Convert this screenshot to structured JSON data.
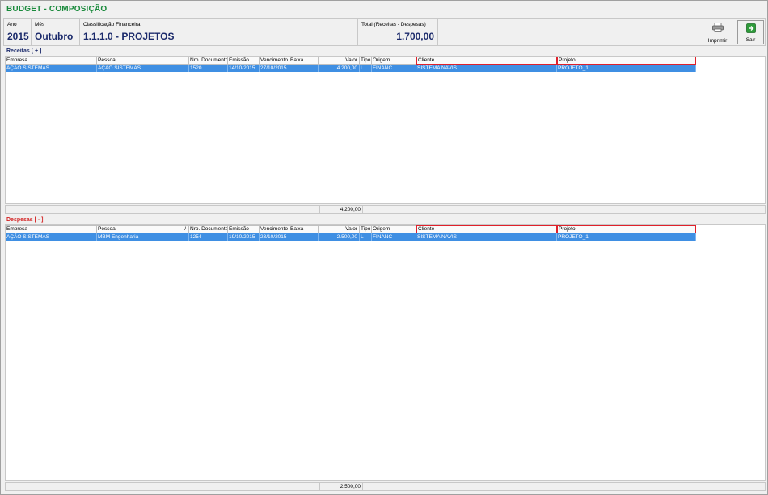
{
  "window": {
    "title": "BUDGET - COMPOSIÇÃO"
  },
  "header": {
    "ano_label": "Ano",
    "ano_value": "2015",
    "mes_label": "Mês",
    "mes_value": "Outubro",
    "classificacao_label": "Classificação Financeira",
    "classificacao_value": "1.1.1.0 - PROJETOS",
    "total_label": "Total (Receitas - Despesas)",
    "total_value": "1.700,00"
  },
  "toolbar": {
    "print_label": "Imprimir",
    "exit_label": "Sair"
  },
  "columns": {
    "empresa": "Empresa",
    "pessoa": "Pessoa",
    "nro_documento": "Nro. Documento",
    "emissao": "Emissão",
    "vencimento": "Vencimento",
    "baixa": "Baixa",
    "valor": "Valor",
    "tipo": "Tipo",
    "origem": "Origem",
    "cliente": "Cliente",
    "projeto": "Projeto"
  },
  "receitas": {
    "title": "Receitas [ + ]",
    "rows": [
      {
        "empresa": "AÇÃO SISTEMAS",
        "pessoa": "AÇÃO SISTEMAS",
        "nro_documento": "1520",
        "emissao": "14/10/2015",
        "vencimento": "27/10/2015",
        "baixa": "",
        "valor": "4.200,00",
        "tipo": "L",
        "origem": "FINANC",
        "cliente": "SISTEMA NAVIS",
        "projeto": "PROJETO_1"
      }
    ],
    "total": "4.200,00"
  },
  "despesas": {
    "title": "Despesas [ - ]",
    "sort_indicator": "/",
    "rows": [
      {
        "empresa": "AÇÃO SISTEMAS",
        "pessoa": "MBM Engenharia",
        "nro_documento": "1254",
        "emissao": "19/10/2015",
        "vencimento": "23/10/2015",
        "baixa": "",
        "valor": "2.500,00",
        "tipo": "L",
        "origem": "FINANC",
        "cliente": "SISTEMA NAVIS",
        "projeto": "PROJETO_1"
      }
    ],
    "total": "2.500,00"
  },
  "colors": {
    "title_green": "#1a8a3c",
    "value_navy": "#1b2a6b",
    "despesas_red": "#d42222",
    "selection_blue": "#3f8fe3",
    "highlight_red": "#e0202a"
  }
}
